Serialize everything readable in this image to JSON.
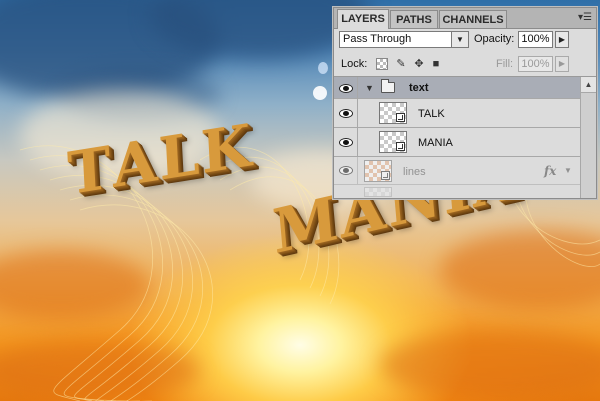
{
  "artwork": {
    "words": [
      {
        "text": "TALK",
        "letters": [
          "T",
          "A",
          "L",
          "K"
        ]
      },
      {
        "text": "MANIA",
        "letters": [
          "M",
          "A",
          "N",
          "I",
          "A"
        ]
      }
    ],
    "colors": {
      "text_face": "#d89a3c",
      "text_extrude": "#6e4412",
      "sky_top": "#2f6fa8",
      "sun": "#fff3a0"
    }
  },
  "panel": {
    "tabs": [
      {
        "label": "LAYERS",
        "active": true
      },
      {
        "label": "PATHS",
        "active": false
      },
      {
        "label": "CHANNELS",
        "active": false
      }
    ],
    "menu_icon": "panel-menu-icon",
    "blend_mode": "Pass Through",
    "opacity_label": "Opacity:",
    "opacity_value": "100%",
    "lock_label": "Lock:",
    "lock_icons": [
      "lock-transparent-pixels-icon",
      "lock-image-pixels-icon",
      "lock-position-icon",
      "lock-all-icon"
    ],
    "fill_label": "Fill:",
    "fill_value": "100%",
    "layers": {
      "group": {
        "name": "text",
        "visible": true,
        "expanded": true
      },
      "children": [
        {
          "name": "TALK",
          "type": "smart-object",
          "visible": true
        },
        {
          "name": "MANIA",
          "type": "smart-object",
          "visible": true
        }
      ],
      "lines": {
        "name": "lines",
        "type": "smart-object",
        "visible": true,
        "fx": "fx"
      }
    }
  }
}
